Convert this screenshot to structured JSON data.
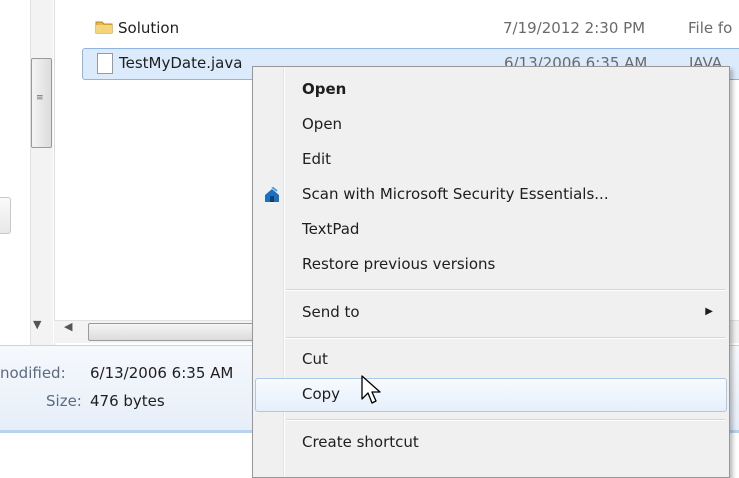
{
  "files": [
    {
      "name": "Solution",
      "date": "7/19/2012 2:30 PM",
      "type": "File fo",
      "icon": "folder-icon"
    },
    {
      "name": "TestMyDate.java",
      "date": "6/13/2006 6:35 AM",
      "type": "JAVA",
      "icon": "file-icon"
    }
  ],
  "details": {
    "modified_label": "nodified:",
    "modified_value": "6/13/2006 6:35 AM",
    "size_label": "Size:",
    "size_value": "476 bytes"
  },
  "context_menu": {
    "items": [
      {
        "label": "Open",
        "bold": true
      },
      {
        "label": "Open"
      },
      {
        "label": "Edit"
      },
      {
        "label": "Scan with Microsoft Security Essentials...",
        "icon": "microsoft-security-essentials-icon"
      },
      {
        "label": "TextPad"
      },
      {
        "label": "Restore previous versions"
      },
      {
        "label": "Send to",
        "submenu": true
      },
      {
        "label": "Cut"
      },
      {
        "label": "Copy",
        "hovered": true
      },
      {
        "label": "Create shortcut"
      }
    ]
  },
  "colors": {
    "selection_bg": "#dcebfc",
    "selection_border": "#8fb4e3",
    "menu_bg": "#f0f0f0",
    "hover_border": "#a8c8ec"
  }
}
